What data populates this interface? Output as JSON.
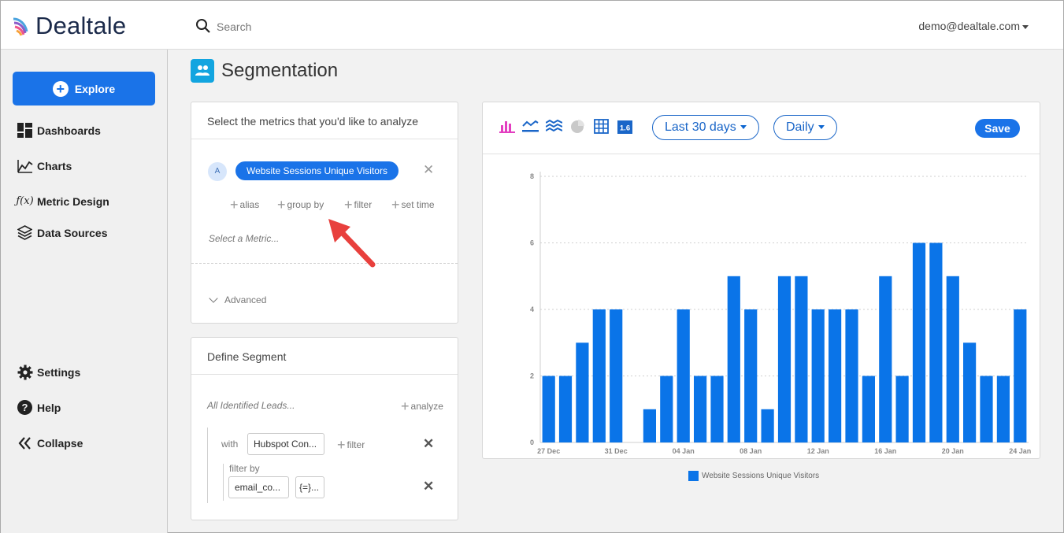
{
  "app": {
    "name": "Dealtale"
  },
  "header": {
    "search": {
      "placeholder": "Search",
      "value": ""
    },
    "user_email": "demo@dealtale.com"
  },
  "sidebar": {
    "explore_label": "Explore",
    "items": [
      {
        "label": "Dashboards",
        "icon": "dashboards-icon"
      },
      {
        "label": "Charts",
        "icon": "charts-icon"
      },
      {
        "label": "Metric Design",
        "icon": "function-icon"
      },
      {
        "label": "Data Sources",
        "icon": "layers-icon"
      }
    ],
    "bottom_items": [
      {
        "label": "Settings",
        "icon": "gear-icon"
      },
      {
        "label": "Help",
        "icon": "help-icon"
      },
      {
        "label": "Collapse",
        "icon": "collapse-icon"
      }
    ]
  },
  "page": {
    "title": "Segmentation",
    "icon": "people-icon"
  },
  "metrics_panel": {
    "header": "Select the metrics that you'd like to analyze",
    "metric_letter": "A",
    "metric_name": "Website Sessions Unique Visitors",
    "options": [
      "alias",
      "group by",
      "filter",
      "set time"
    ],
    "select_placeholder": "Select a Metric...",
    "advanced_label": "Advanced"
  },
  "segment_panel": {
    "header": "Define Segment",
    "base_label": "All Identified Leads...",
    "analyze_label": "analyze",
    "with_label": "with",
    "with_value": "Hubspot Con...",
    "filter_label": "filter",
    "filter_by_label": "filter by",
    "filter_field_value": "email_co...",
    "filter_operator_value": "{=}..."
  },
  "chart_toolbar": {
    "icons": [
      "bar-chart-icon",
      "line-chart-icon",
      "area-chart-icon",
      "pie-chart-icon",
      "table-icon",
      "number-icon"
    ],
    "number_icon_text": "1.6",
    "range_label": "Last 30 days",
    "interval_label": "Daily",
    "save_label": "Save"
  },
  "colors": {
    "accent": "#1a73e8",
    "bar": "#0a74e8",
    "title_icon_bg": "#12a5e0",
    "selected_chart_icon": "#e33ec0"
  },
  "chart_data": {
    "type": "bar",
    "x_tick_labels": [
      "27 Dec",
      "31 Dec",
      "04 Jan",
      "08 Jan",
      "12 Jan",
      "16 Jan",
      "20 Jan",
      "24 Jan"
    ],
    "y_ticks": [
      0,
      2,
      4,
      6,
      8
    ],
    "ylim": [
      0,
      8
    ],
    "grid": "horizontal dotted",
    "legend_position": "bottom",
    "series": [
      {
        "name": "Website Sessions Unique Visitors",
        "color": "#0a74e8",
        "values": [
          2,
          2,
          3,
          4,
          4,
          0,
          1,
          2,
          4,
          2,
          2,
          5,
          4,
          1,
          5,
          5,
          4,
          4,
          4,
          2,
          5,
          2,
          6,
          6,
          5,
          3,
          2,
          2,
          4
        ]
      }
    ]
  }
}
